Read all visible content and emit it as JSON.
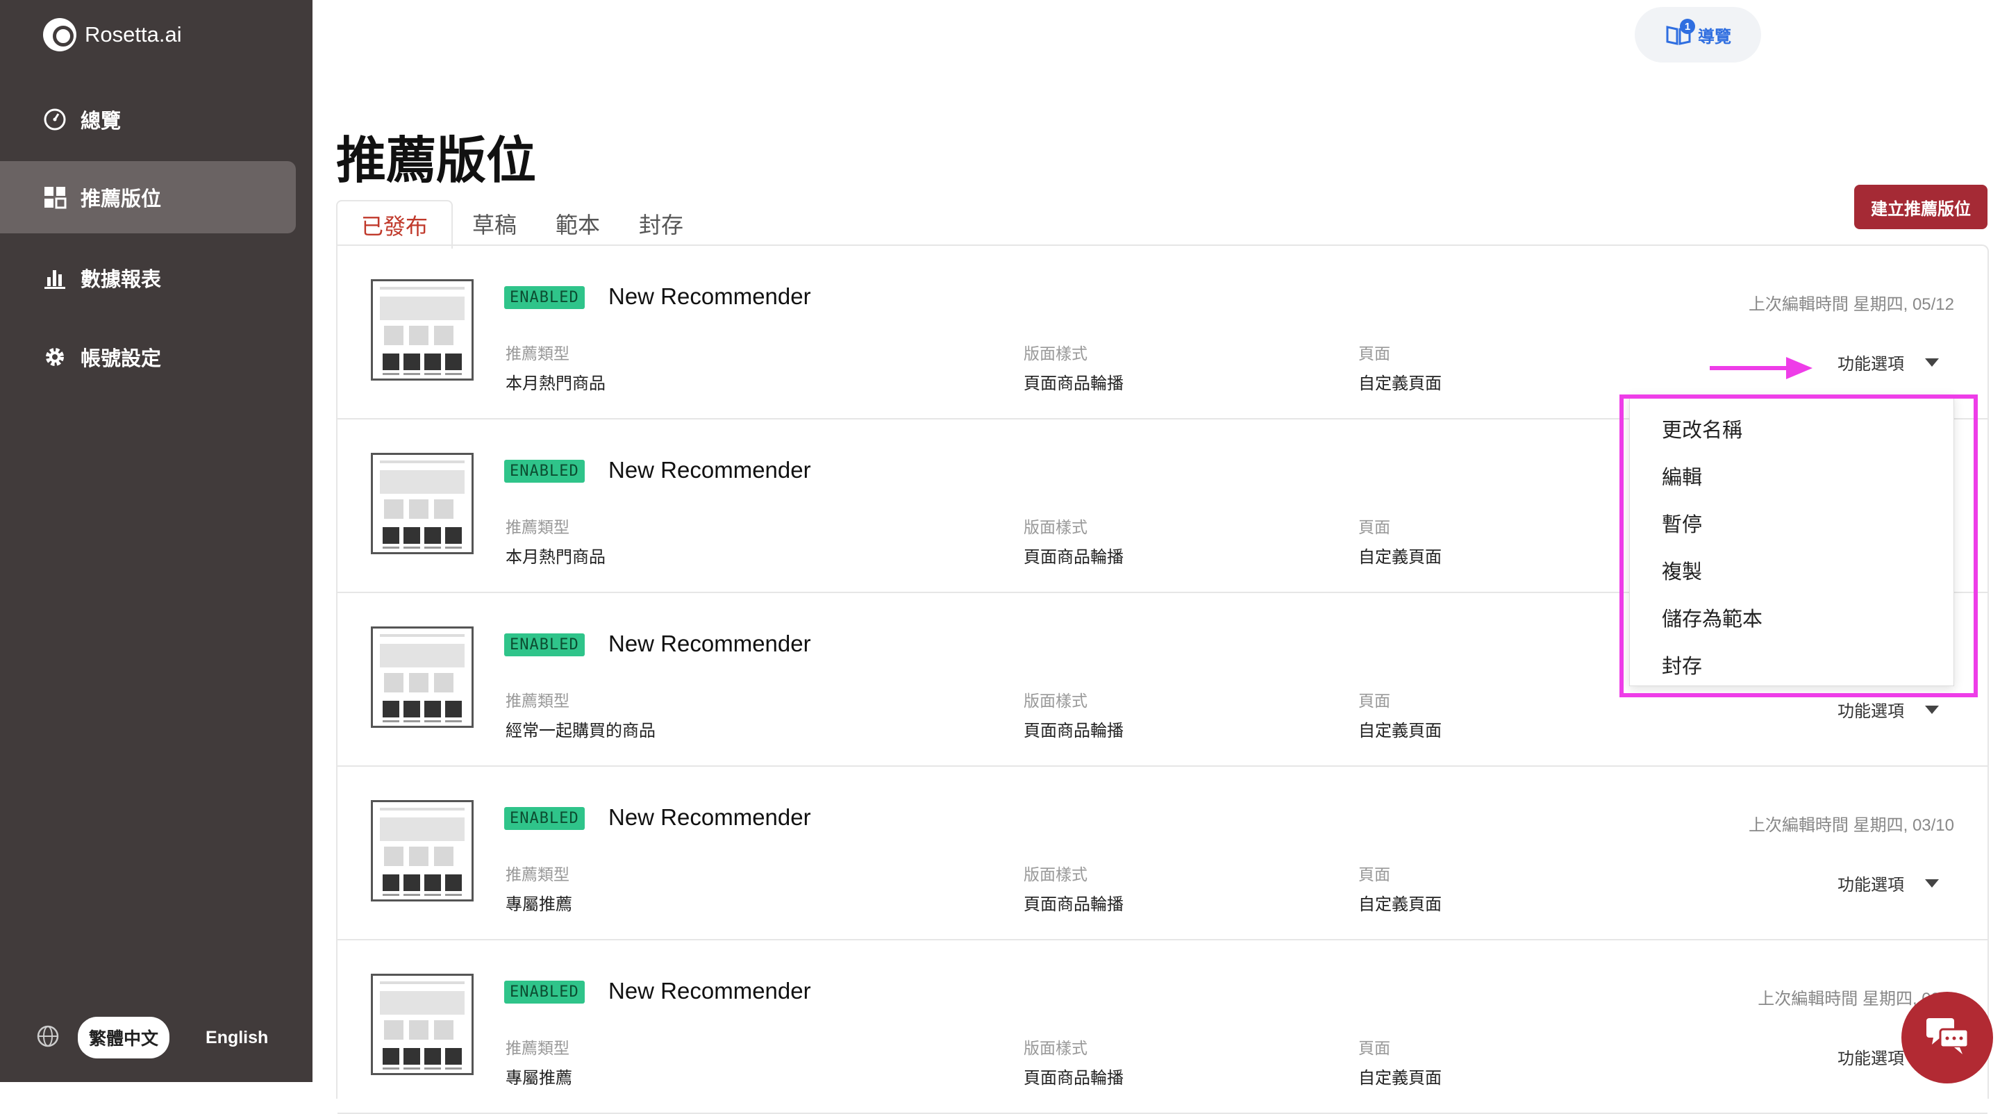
{
  "brand": {
    "name": "Rosetta.ai"
  },
  "sidebar": {
    "items": [
      {
        "label": "總覽",
        "icon": "dashboard-icon"
      },
      {
        "label": "推薦版位",
        "icon": "grid-icon",
        "active": true
      },
      {
        "label": "數據報表",
        "icon": "bar-chart-icon"
      },
      {
        "label": "帳號設定",
        "icon": "gear-icon"
      }
    ],
    "language": {
      "current": "繁體中文",
      "other": "English"
    }
  },
  "header": {
    "guide_label": "導覽",
    "guide_badge": "1"
  },
  "page": {
    "title": "推薦版位",
    "create_button": "建立推薦版位"
  },
  "tabs": [
    {
      "label": "已發布",
      "active": true
    },
    {
      "label": "草稿"
    },
    {
      "label": "範本"
    },
    {
      "label": "封存"
    }
  ],
  "labels": {
    "type": "推薦類型",
    "layout": "版面樣式",
    "page": "頁面",
    "options": "功能選項"
  },
  "rows": [
    {
      "status": "ENABLED",
      "name": "New Recommender",
      "edited": "上次編輯時間 星期四, 05/12",
      "type": "本月熱門商品",
      "layout": "頁面商品輪播",
      "page": "自定義頁面"
    },
    {
      "status": "ENABLED",
      "name": "New Recommender",
      "edited": "",
      "type": "本月熱門商品",
      "layout": "頁面商品輪播",
      "page": "自定義頁面"
    },
    {
      "status": "ENABLED",
      "name": "New Recommender",
      "edited": "",
      "type": "經常一起購買的商品",
      "layout": "頁面商品輪播",
      "page": "自定義頁面"
    },
    {
      "status": "ENABLED",
      "name": "New Recommender",
      "edited": "上次編輯時間 星期四, 03/10",
      "type": "專屬推薦",
      "layout": "頁面商品輪播",
      "page": "自定義頁面"
    },
    {
      "status": "ENABLED",
      "name": "New Recommender",
      "edited": "上次編輯時間 星期四, 03/1",
      "type": "專屬推薦",
      "layout": "頁面商品輪播",
      "page": "自定義頁面"
    }
  ],
  "dropdown": {
    "items": [
      "更改名稱",
      "編輯",
      "暫停",
      "複製",
      "儲存為範本",
      "封存"
    ]
  },
  "colors": {
    "sidebar": "#413b3b",
    "accent": "#a52a35",
    "enabled": "#2fc48a",
    "highlight": "#ee3de8",
    "guide": "#2f6ee0"
  }
}
